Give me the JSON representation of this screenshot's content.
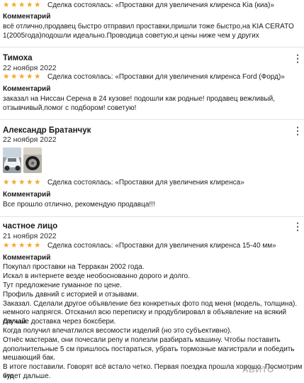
{
  "colors": {
    "star": "#f5a623",
    "divider": "#e4e4e4",
    "text": "#1a1a1a"
  },
  "reviews": [
    {
      "author": "",
      "date": "",
      "stars": 5,
      "deal": "Сделка состоялась: «Проставки для увеличения клиренса Kia (киа)»",
      "comment_title": "Комментарий",
      "comment_lines": [
        "всё отлично,продавец быстро отправил проставки,пришли тоже быстро,на KIA CERATO",
        "1(2005года)подошли идеально.Прoводица советую,и цены ниже чем у других"
      ]
    },
    {
      "author": "Тимоха",
      "date": "22 ноября 2022",
      "stars": 5,
      "deal": "Сделка состоялась: «Проставки для увеличения клиренса Ford (Форд)»",
      "comment_title": "Комментарий",
      "comment_lines": [
        "заказал на Ниссан Серена в 24 кузове! подошли как родные! продавец вежливый,",
        "отзывчивый,помог с подбором! советую!"
      ]
    },
    {
      "author": "Александр Братанчук",
      "date": "22 ноября 2022",
      "stars": 5,
      "deal": "Сделка состоялась: «Проставки для увеличения клиренса»",
      "comment_title": "Комментарий",
      "comment_lines": [
        "Все прошло отлично, рекомендую продавца!!!"
      ]
    },
    {
      "author": "частное лицо",
      "date": "21 ноября 2022",
      "stars": 5,
      "deal": "Сделка состоялась: «Проставки для увеличения клиренса 15-40 мм»",
      "comment_title": "Комментарий",
      "comment_lines": [
        "Покупал проставки на Терракан 2002 года.",
        "Искал в интернете везде необоснованно дорого и долго.",
        "Тут предложение гуманное по цене.",
        "Профиль давний с историей и отзывами.",
        "Заказал. Сделали другое объявление без конкретных фото под меня (модель, толщина).",
        "немного напрягся. Отсканил всю переписку и продублировал в объявление на всякий случай.",
        "Дальше доставка через боксбери.",
        "Когда получил впечатлился весомости изделий (но это субъективно).",
        "Отнёс мастерам, они почесали репу и полезли разбирать машину. Чтобы поставить",
        "дополнительные 5 см пришлось постараться, убрать тормозные магистрали и победить",
        "мешающий бак.",
        "В итоге поставили. Говорят всё встало четко. Первая поездка прошла хорошо. Посмотрим что",
        "будет дальше."
      ]
    }
  ],
  "watermark": "АВИТО"
}
